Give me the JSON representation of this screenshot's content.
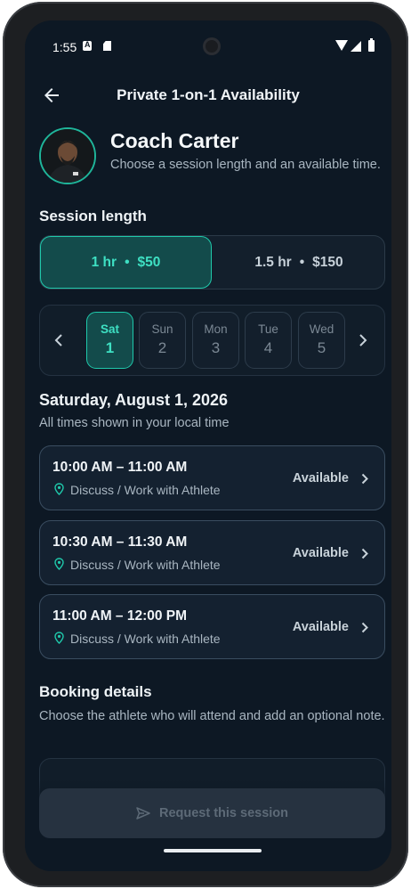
{
  "status_bar": {
    "time": "1:55"
  },
  "app_bar": {
    "title": "Private 1-on-1 Availability",
    "back_icon": "arrow-left-icon"
  },
  "coach": {
    "name": "Coach Carter",
    "subtitle": "Choose a session length and an available time."
  },
  "session_length": {
    "heading": "Session length",
    "options": [
      {
        "duration": "1 hr",
        "separator": "•",
        "price": "$50",
        "selected": true
      },
      {
        "duration": "1.5 hr",
        "separator": "•",
        "price": "$150",
        "selected": false
      }
    ]
  },
  "date_picker": {
    "days": [
      {
        "name": "Sat",
        "num": "1",
        "selected": true
      },
      {
        "name": "Sun",
        "num": "2",
        "selected": false
      },
      {
        "name": "Mon",
        "num": "3",
        "selected": false
      },
      {
        "name": "Tue",
        "num": "4",
        "selected": false
      },
      {
        "name": "Wed",
        "num": "5",
        "selected": false
      }
    ]
  },
  "selected_date": {
    "heading": "Saturday, August 1, 2026",
    "timezone_note": "All times shown in your local time"
  },
  "slots": [
    {
      "time": "10:00 AM – 11:00 AM",
      "location": "Discuss / Work with Athlete",
      "status": "Available"
    },
    {
      "time": "10:30 AM – 11:30 AM",
      "location": "Discuss / Work with Athlete",
      "status": "Available"
    },
    {
      "time": "11:00 AM – 12:00 PM",
      "location": "Discuss / Work with Athlete",
      "status": "Available"
    }
  ],
  "booking": {
    "heading": "Booking details",
    "subtitle": "Choose the athlete who will attend and add an optional note."
  },
  "cta": {
    "label": "Request this session",
    "enabled": false
  },
  "colors": {
    "accent": "#1fc9ab",
    "background": "#0d1824",
    "card": "#142130"
  }
}
